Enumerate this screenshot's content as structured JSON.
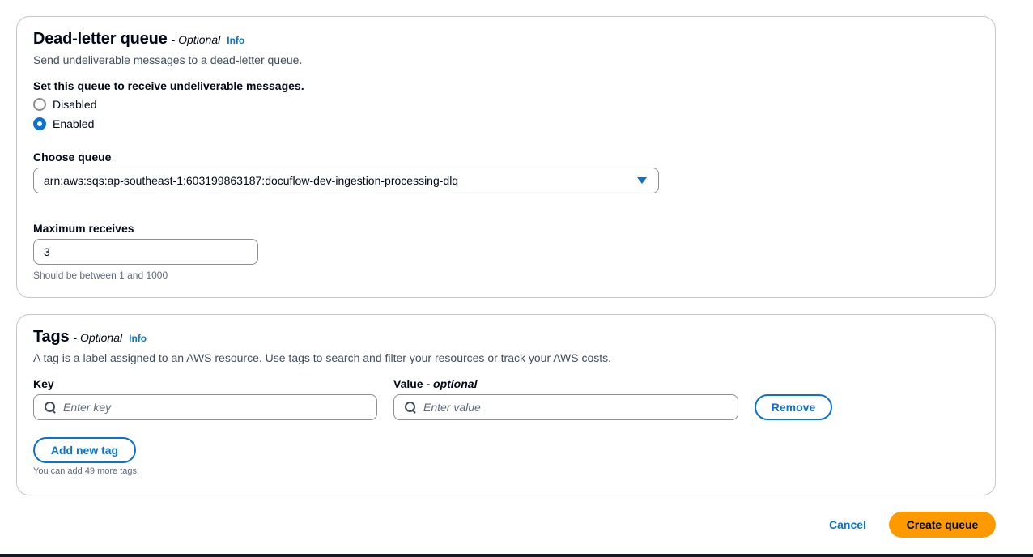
{
  "dlq": {
    "title": "Dead-letter queue",
    "optional": "- Optional",
    "info": "Info",
    "description": "Send undeliverable messages to a dead-letter queue.",
    "radio_group_label": "Set this queue to receive undeliverable messages.",
    "options": [
      {
        "label": "Disabled",
        "selected": false
      },
      {
        "label": "Enabled",
        "selected": true
      }
    ],
    "choose_queue_label": "Choose queue",
    "queue_value": "arn:aws:sqs:ap-southeast-1:603199863187:docuflow-dev-ingestion-processing-dlq",
    "max_receives_label": "Maximum receives",
    "max_receives_value": "3",
    "max_receives_hint": "Should be between 1 and 1000"
  },
  "tags": {
    "title": "Tags",
    "optional": "- Optional",
    "info": "Info",
    "description": "A tag is a label assigned to an AWS resource. Use tags to search and filter your resources or track your AWS costs.",
    "key_label": "Key",
    "value_label": "Value -",
    "value_label_optional": "optional",
    "key_placeholder": "Enter key",
    "value_placeholder": "Enter value",
    "remove_label": "Remove",
    "add_label": "Add new tag",
    "limit_hint": "You can add 49 more tags."
  },
  "footer": {
    "cancel_label": "Cancel",
    "create_label": "Create queue"
  },
  "colors": {
    "accent": "#0972d3",
    "primary_button": "#ff9900"
  }
}
